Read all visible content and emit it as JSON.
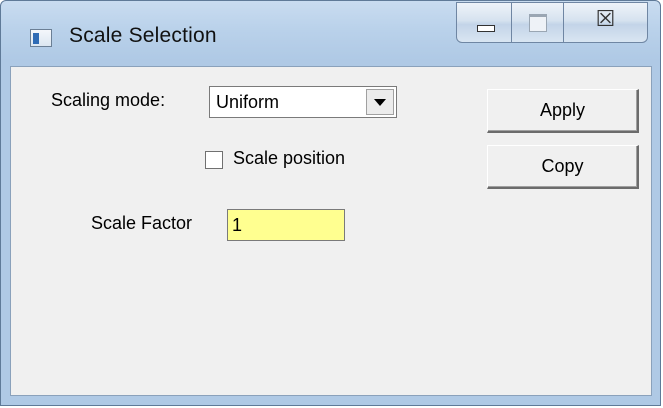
{
  "window": {
    "title": "Scale Selection",
    "close_symbol": "☒"
  },
  "icons": {
    "app": "app-window-icon",
    "minimize": "minimize-icon",
    "maximize": "maximize-icon",
    "close": "close-icon",
    "dropdown": "chevron-down-icon"
  },
  "form": {
    "scaling_mode_label": "Scaling mode:",
    "scaling_mode_value": "Uniform",
    "scale_position_label": "Scale position",
    "scale_position_checked": false,
    "scale_factor_label": "Scale Factor",
    "scale_factor_value": "1"
  },
  "buttons": {
    "apply": "Apply",
    "copy": "Copy"
  },
  "colors": {
    "input_highlight": "#ffff90",
    "dialog_background": "#f0f0f0",
    "frame": "#b9d1ea"
  }
}
